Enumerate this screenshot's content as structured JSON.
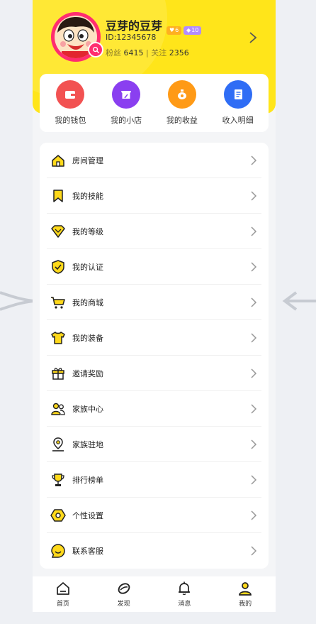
{
  "profile": {
    "name": "豆芽的豆芽",
    "id_text": "ID:12345678",
    "badge_a": "6",
    "badge_b": "10",
    "fans_label": "粉丝",
    "fans_count": "6415",
    "divider": "|",
    "follow_label": "关注",
    "follow_count": "2356"
  },
  "quick_actions": [
    {
      "label": "我的钱包",
      "icon": "wallet-icon",
      "color": "#f25252"
    },
    {
      "label": "我的小店",
      "icon": "store-icon",
      "color": "#8a3ff0"
    },
    {
      "label": "我的收益",
      "icon": "money-bag-icon",
      "color": "#ff9a16"
    },
    {
      "label": "收入明细",
      "icon": "document-icon",
      "color": "#2f6df5"
    }
  ],
  "menu": [
    {
      "label": "房间管理",
      "icon": "house-icon"
    },
    {
      "label": "我的技能",
      "icon": "bookmark-icon"
    },
    {
      "label": "我的等级",
      "icon": "diamond-icon"
    },
    {
      "label": "我的认证",
      "icon": "shield-check-icon"
    },
    {
      "label": "我的商城",
      "icon": "cart-icon"
    },
    {
      "label": "我的装备",
      "icon": "shirt-icon"
    },
    {
      "label": "邀请奖励",
      "icon": "gift-icon"
    },
    {
      "label": "家族中心",
      "icon": "people-icon"
    },
    {
      "label": "家族驻地",
      "icon": "location-pin-icon"
    },
    {
      "label": "排行榜单",
      "icon": "trophy-icon"
    },
    {
      "label": "个性设置",
      "icon": "hexagon-gear-icon"
    },
    {
      "label": "联系客服",
      "icon": "smile-chat-icon"
    }
  ],
  "tabs": [
    {
      "label": "首页",
      "icon": "home-icon"
    },
    {
      "label": "发现",
      "icon": "discover-icon"
    },
    {
      "label": "消息",
      "icon": "bell-icon"
    },
    {
      "label": "我的",
      "icon": "profile-icon"
    }
  ],
  "colors": {
    "accent": "#ffe51a",
    "avatar_ring": "#ff2d6f",
    "icon_line": "#222222",
    "icon_fill": "#ffd91a"
  }
}
